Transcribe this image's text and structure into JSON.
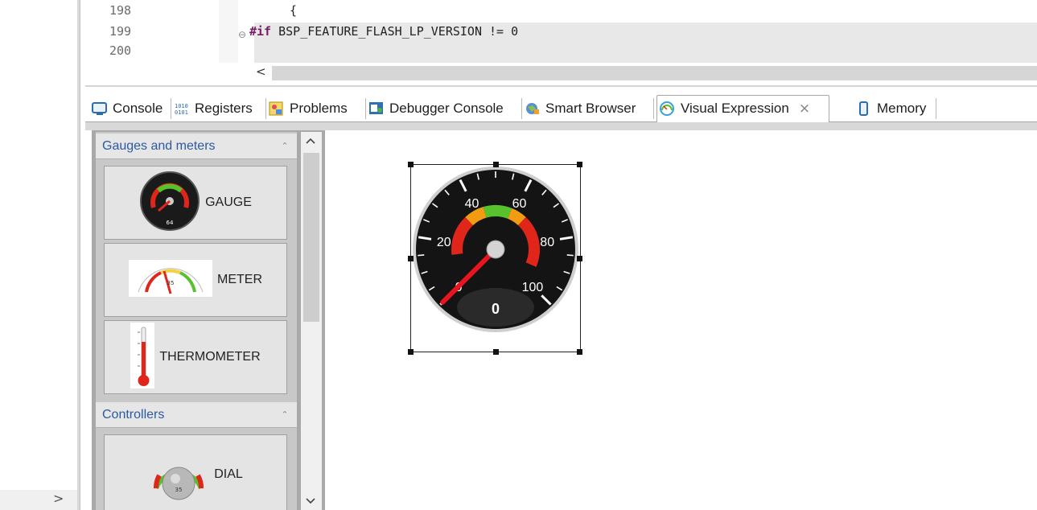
{
  "editor": {
    "line_numbers": [
      "198",
      "199",
      "200"
    ],
    "lines": {
      "brace": "{",
      "directive": "#if",
      "directive_rest": " BSP_FEATURE_FLASH_LP_VERSION != 0"
    },
    "hscroll_left": "<",
    "fold_marker": "⊖"
  },
  "tabs": [
    {
      "label": "Console",
      "icon": "console-icon"
    },
    {
      "label": "Registers",
      "icon": "registers-icon"
    },
    {
      "label": "Problems",
      "icon": "problems-icon"
    },
    {
      "label": "Debugger Console",
      "icon": "debugger-console-icon"
    },
    {
      "label": "Smart Browser",
      "icon": "smart-browser-icon"
    },
    {
      "label": "Visual Expression",
      "icon": "visual-expression-icon",
      "active": true
    },
    {
      "label": "Memory",
      "icon": "memory-icon"
    }
  ],
  "tab_close": "×",
  "palette": {
    "drawers": [
      {
        "title": "Gauges and meters",
        "items": [
          {
            "label": "GAUGE",
            "icon": "gauge-icon"
          },
          {
            "label": "METER",
            "icon": "meter-icon"
          },
          {
            "label": "THERMOMETER",
            "icon": "thermometer-icon"
          }
        ]
      },
      {
        "title": "Controllers",
        "items": [
          {
            "label": "DIAL",
            "icon": "dial-icon"
          }
        ]
      }
    ],
    "collapse_glyph": "⌃"
  },
  "gauge_widget": {
    "ticks": [
      "0",
      "20",
      "40",
      "60",
      "80",
      "100"
    ],
    "value": "0",
    "min": 0,
    "max": 100,
    "colors": {
      "low": "#e0251b",
      "mid": "#f39c12",
      "high": "#57c22b",
      "needle": "#e8141e"
    }
  },
  "misc": {
    "bottom_arrow": ">",
    "scroll_up": "^",
    "scroll_down": "v"
  }
}
